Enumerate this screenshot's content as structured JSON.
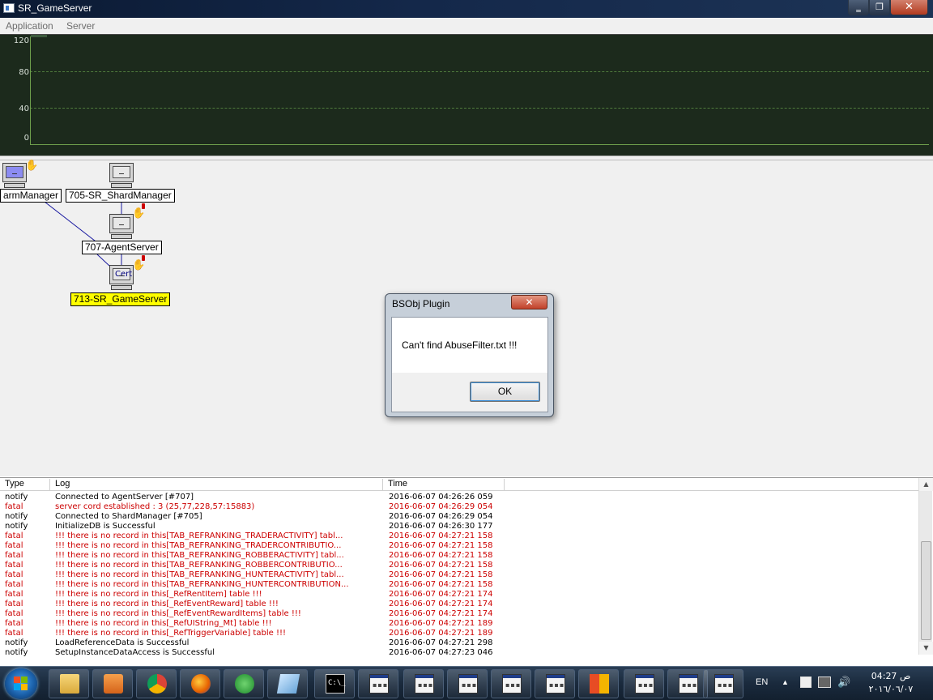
{
  "window": {
    "title": "SR_GameServer",
    "controls": {
      "minimize": "‗",
      "maximize": "❐",
      "close": "✕"
    }
  },
  "menu": {
    "items": [
      "Application",
      "Server"
    ]
  },
  "graph": {
    "y_ticks": [
      "120",
      "80",
      "40",
      "0"
    ],
    "background": "#1c2a1c",
    "line_color": "#6fa04c"
  },
  "diagram": {
    "nodes": [
      {
        "label": "armManager",
        "icon": "computer-icon",
        "highlighted": false
      },
      {
        "label": "705-SR_ShardManager",
        "icon": "computer-icon",
        "highlighted": false
      },
      {
        "label": "707-AgentServer",
        "icon": "computer-icon",
        "highlighted": false
      },
      {
        "label": "713-SR_GameServer",
        "icon": "computer-cert-icon",
        "cert_text": "Cert",
        "highlighted": true
      }
    ],
    "highlight_color": "#ffff00"
  },
  "dialog": {
    "title": "BSObj Plugin",
    "message": "Can't find AbuseFilter.txt !!!",
    "ok_label": "OK",
    "close_label": "✕"
  },
  "log": {
    "columns": [
      "Type",
      "Log",
      "Time"
    ],
    "rows": [
      {
        "type": "notify",
        "log": "Connected to AgentServer [#707]",
        "time": "2016-06-07 04:26:26 059"
      },
      {
        "type": "fatal",
        "log": "server cord established : 3 (25,77,228,57:15883)",
        "time": "2016-06-07 04:26:29 054"
      },
      {
        "type": "notify",
        "log": "Connected to ShardManager [#705]",
        "time": "2016-06-07 04:26:29 054"
      },
      {
        "type": "notify",
        "log": "InitializeDB is Successful",
        "time": "2016-06-07 04:26:30 177"
      },
      {
        "type": "fatal",
        "log": "!!! there is no record in this[TAB_REFRANKING_TRADERACTIVITY] tabl...",
        "time": "2016-06-07 04:27:21 158"
      },
      {
        "type": "fatal",
        "log": "!!! there is no record in this[TAB_REFRANKING_TRADERCONTRIBUTIO...",
        "time": "2016-06-07 04:27:21 158"
      },
      {
        "type": "fatal",
        "log": "!!! there is no record in this[TAB_REFRANKING_ROBBERACTIVITY] tabl...",
        "time": "2016-06-07 04:27:21 158"
      },
      {
        "type": "fatal",
        "log": "!!! there is no record in this[TAB_REFRANKING_ROBBERCONTRIBUTIO...",
        "time": "2016-06-07 04:27:21 158"
      },
      {
        "type": "fatal",
        "log": "!!! there is no record in this[TAB_REFRANKING_HUNTERACTIVITY] tabl...",
        "time": "2016-06-07 04:27:21 158"
      },
      {
        "type": "fatal",
        "log": "!!! there is no record in this[TAB_REFRANKING_HUNTERCONTRIBUTION...",
        "time": "2016-06-07 04:27:21 158"
      },
      {
        "type": "fatal",
        "log": "!!! there is no record in this[_RefRentItem] table !!!",
        "time": "2016-06-07 04:27:21 174"
      },
      {
        "type": "fatal",
        "log": "!!! there is no record in this[_RefEventReward] table !!!",
        "time": "2016-06-07 04:27:21 174"
      },
      {
        "type": "fatal",
        "log": "!!! there is no record in this[_RefEventRewardItems] table !!!",
        "time": "2016-06-07 04:27:21 174"
      },
      {
        "type": "fatal",
        "log": "!!! there is no record in this[_RefUIString_Mt] table !!!",
        "time": "2016-06-07 04:27:21 189"
      },
      {
        "type": "fatal",
        "log": "!!! there is no record in this[_RefTriggerVariable] table !!!",
        "time": "2016-06-07 04:27:21 189"
      },
      {
        "type": "notify",
        "log": "LoadReferenceData is Successful",
        "time": "2016-06-07 04:27:21 298"
      },
      {
        "type": "notify",
        "log": "SetupInstanceDataAccess is Successful",
        "time": "2016-06-07 04:27:23 046"
      }
    ],
    "fatal_color": "#cc0000",
    "scroll": {
      "up": "▲",
      "down": "▼"
    }
  },
  "taskbar": {
    "pinned": [
      "windows-explorer-icon",
      "media-player-icon",
      "chrome-icon",
      "firefox-icon",
      "network-globe-icon",
      "notepad-icon",
      "command-prompt-icon",
      "app-window-icon",
      "app-window-icon",
      "app-window-icon",
      "app-window-icon",
      "app-window-icon",
      "office-icon",
      "app-window-icon",
      "app-window-icon",
      "app-window-icon"
    ],
    "cmd_text": "C:\\_",
    "tray": {
      "language": "EN",
      "arrow": "▲"
    },
    "clock": {
      "time": "04:27 ص",
      "date": "٢٠١٦/٠٦/٠٧"
    }
  }
}
